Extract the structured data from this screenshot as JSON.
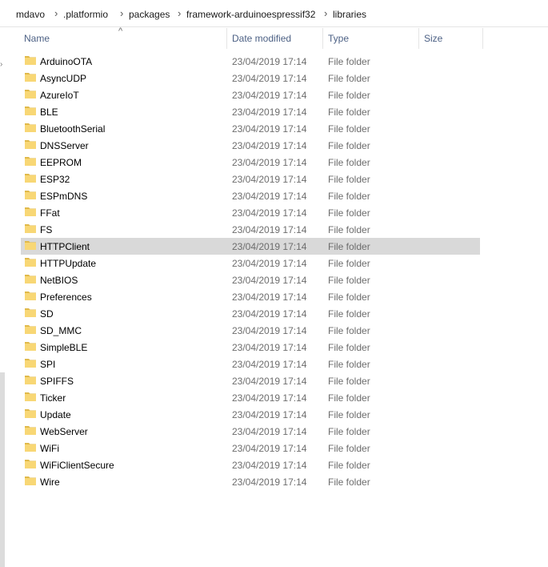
{
  "breadcrumb": [
    "mdavo",
    ".platformio",
    "packages",
    "framework-arduinoespressif32",
    "libraries"
  ],
  "columns": {
    "name": "Name",
    "date": "Date modified",
    "type": "Type",
    "size": "Size"
  },
  "rows": [
    {
      "name": "ArduinoOTA",
      "date": "23/04/2019 17:14",
      "type": "File folder"
    },
    {
      "name": "AsyncUDP",
      "date": "23/04/2019 17:14",
      "type": "File folder"
    },
    {
      "name": "AzureIoT",
      "date": "23/04/2019 17:14",
      "type": "File folder"
    },
    {
      "name": "BLE",
      "date": "23/04/2019 17:14",
      "type": "File folder"
    },
    {
      "name": "BluetoothSerial",
      "date": "23/04/2019 17:14",
      "type": "File folder"
    },
    {
      "name": "DNSServer",
      "date": "23/04/2019 17:14",
      "type": "File folder"
    },
    {
      "name": "EEPROM",
      "date": "23/04/2019 17:14",
      "type": "File folder"
    },
    {
      "name": "ESP32",
      "date": "23/04/2019 17:14",
      "type": "File folder"
    },
    {
      "name": "ESPmDNS",
      "date": "23/04/2019 17:14",
      "type": "File folder"
    },
    {
      "name": "FFat",
      "date": "23/04/2019 17:14",
      "type": "File folder"
    },
    {
      "name": "FS",
      "date": "23/04/2019 17:14",
      "type": "File folder"
    },
    {
      "name": "HTTPClient",
      "date": "23/04/2019 17:14",
      "type": "File folder",
      "selected": true
    },
    {
      "name": "HTTPUpdate",
      "date": "23/04/2019 17:14",
      "type": "File folder"
    },
    {
      "name": "NetBIOS",
      "date": "23/04/2019 17:14",
      "type": "File folder"
    },
    {
      "name": "Preferences",
      "date": "23/04/2019 17:14",
      "type": "File folder"
    },
    {
      "name": "SD",
      "date": "23/04/2019 17:14",
      "type": "File folder"
    },
    {
      "name": "SD_MMC",
      "date": "23/04/2019 17:14",
      "type": "File folder"
    },
    {
      "name": "SimpleBLE",
      "date": "23/04/2019 17:14",
      "type": "File folder"
    },
    {
      "name": "SPI",
      "date": "23/04/2019 17:14",
      "type": "File folder"
    },
    {
      "name": "SPIFFS",
      "date": "23/04/2019 17:14",
      "type": "File folder"
    },
    {
      "name": "Ticker",
      "date": "23/04/2019 17:14",
      "type": "File folder"
    },
    {
      "name": "Update",
      "date": "23/04/2019 17:14",
      "type": "File folder"
    },
    {
      "name": "WebServer",
      "date": "23/04/2019 17:14",
      "type": "File folder"
    },
    {
      "name": "WiFi",
      "date": "23/04/2019 17:14",
      "type": "File folder"
    },
    {
      "name": "WiFiClientSecure",
      "date": "23/04/2019 17:14",
      "type": "File folder"
    },
    {
      "name": "Wire",
      "date": "23/04/2019 17:14",
      "type": "File folder"
    }
  ],
  "icons": {
    "folder": "folder-icon",
    "separator": "chevron-right-icon",
    "sort": "sort-up-icon"
  },
  "colors": {
    "folder": "#f8d775",
    "folder_dark": "#e0b94a",
    "selected": "#d9d9d9",
    "header_text": "#4d6185"
  }
}
